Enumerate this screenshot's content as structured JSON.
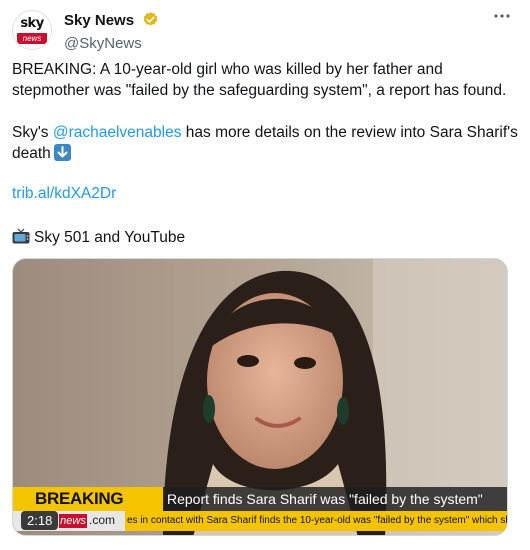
{
  "account": {
    "display_name": "Sky News",
    "handle": "@SkyNews",
    "avatar_top": "sky",
    "avatar_bottom": "news"
  },
  "tweet": {
    "para1": "BREAKING: A 10-year-old girl who was killed by her father and stepmother was \"failed by the safeguarding system\", a report has found.",
    "para2_before": "Sky's ",
    "para2_mention": "@rachaelvenables",
    "para2_after": " has more details on the review into Sara Sharif's death",
    "link": "trib.al/kdXA2Dr",
    "source": "Sky 501 and YouTube"
  },
  "media": {
    "breaking_label": "BREAKING NEWS",
    "headline": "Report finds Sara Sharif was \"failed by the system\"",
    "ticker_logo_red": "news",
    "ticker_logo_suffix": ".com",
    "ticker_text": "es in contact with Sara Sharif finds the 10-year-old was \"failed by the system\" which shou",
    "duration": "2:18"
  },
  "icons": {
    "verified": "verified-badge-icon",
    "more": "more-options-icon",
    "down_arrow": "down-arrow-emoji-icon",
    "tv": "television-emoji-icon"
  },
  "colors": {
    "link": "#1d9bf0",
    "breaking_yellow": "#f5c400",
    "sky_red": "#c8102e"
  }
}
